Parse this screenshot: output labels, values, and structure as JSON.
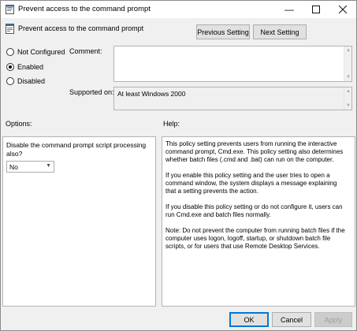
{
  "window": {
    "title": "Prevent access to the command prompt",
    "subtitle": "Prevent access to the command prompt"
  },
  "nav": {
    "previous": "Previous Setting",
    "next": "Next Setting"
  },
  "state": {
    "options": [
      "Not Configured",
      "Enabled",
      "Disabled"
    ],
    "selected": "Enabled"
  },
  "comment_label": "Comment:",
  "supported_label": "Supported on:",
  "supported_value": "At least Windows 2000",
  "options_label": "Options:",
  "help_label": "Help:",
  "option_question": "Disable the command prompt script processing also?",
  "option_value": "No",
  "help_paragraphs": [
    "This policy setting prevents users from running the interactive command prompt, Cmd.exe.  This policy setting also determines whether batch files (.cmd and .bat) can run on the computer.",
    "If you enable this policy setting and the user tries to open a command window, the system displays a message explaining that a setting prevents the action.",
    "If you disable this policy setting or do not configure it, users can run Cmd.exe and batch files normally.",
    "Note: Do not prevent the computer from running batch files if the computer uses logon, logoff, startup, or shutdown batch file scripts, or for users that use Remote Desktop Services."
  ],
  "buttons": {
    "ok": "OK",
    "cancel": "Cancel",
    "apply": "Apply"
  },
  "icons": {
    "app": "policy-icon",
    "minimize": "minimize-icon",
    "maximize": "maximize-icon",
    "close": "close-icon"
  }
}
